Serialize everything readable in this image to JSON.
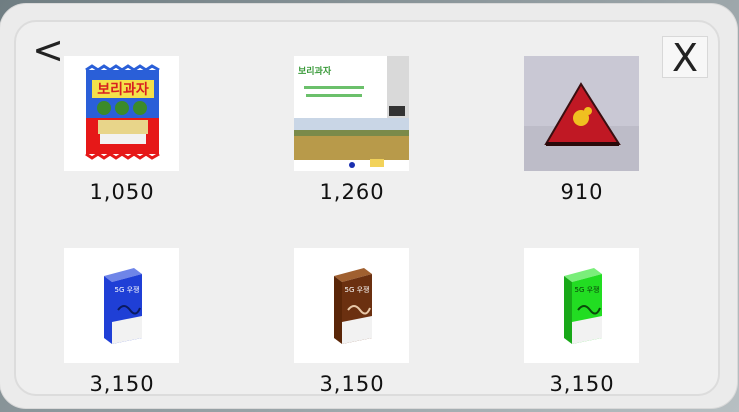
{
  "dialog": {
    "back_label": "<",
    "close_label": "X"
  },
  "items": [
    {
      "price": "1,050",
      "package_text": "보리과자"
    },
    {
      "price": "1,260",
      "package_text": "보리과자"
    },
    {
      "price": "910",
      "package_text": ""
    },
    {
      "price": "3,150",
      "package_text": "5G 우쟁",
      "box_color": "#1f3fd6"
    },
    {
      "price": "3,150",
      "package_text": "5G 우쟁",
      "box_color": "#6b3010"
    },
    {
      "price": "3,150",
      "package_text": "5G 우쟁",
      "box_color": "#22dd22"
    }
  ]
}
